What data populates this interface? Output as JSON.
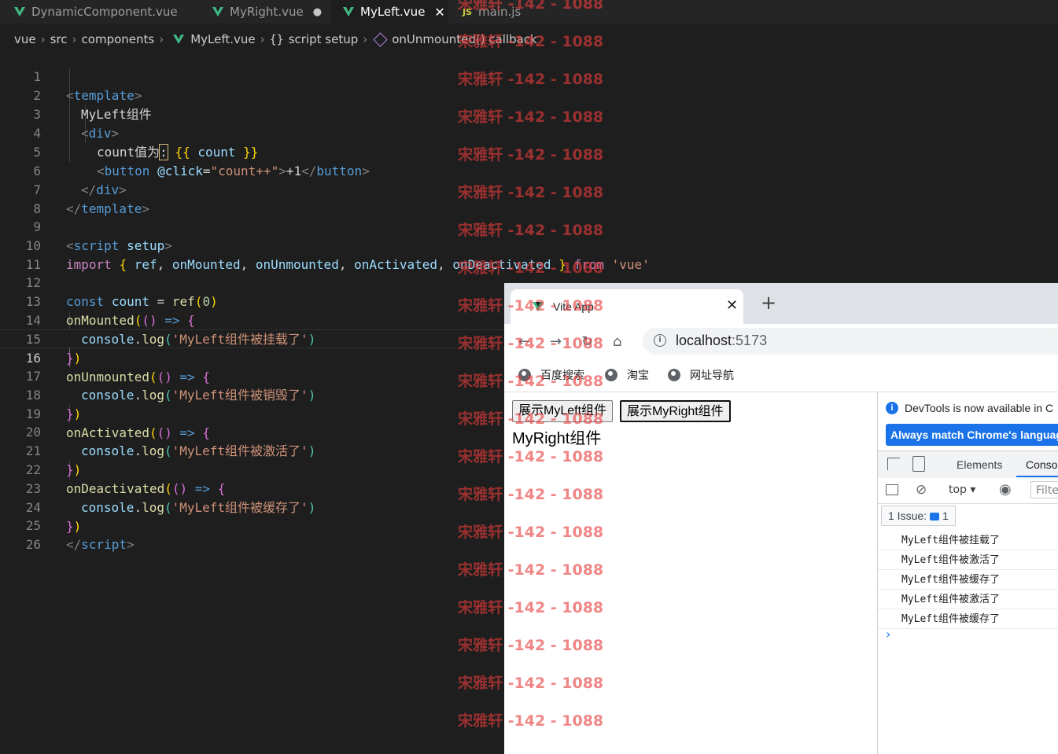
{
  "editor": {
    "tabs": [
      {
        "label": "DynamicComponent.vue",
        "icon": "vue-icon",
        "active": false
      },
      {
        "label": "MyRight.vue",
        "icon": "vue-icon",
        "modified": true,
        "active": false
      },
      {
        "label": "MyLeft.vue",
        "icon": "vue-icon",
        "active": true
      },
      {
        "label": "main.js",
        "icon": "js-icon",
        "active": false
      }
    ],
    "js_badge": "JS",
    "breadcrumb": [
      "vue",
      "src",
      "components",
      "MyLeft.vue",
      "script setup",
      "onUnmounted() callback"
    ],
    "breadcrumb_braces": "{}",
    "lines": [
      "1",
      "2",
      "3",
      "4",
      "5",
      "6",
      "7",
      "8",
      "9",
      "10",
      "11",
      "12",
      "13",
      "14",
      "15",
      "16",
      "17",
      "18",
      "19",
      "20",
      "21",
      "22",
      "23",
      "24",
      "25",
      "26"
    ],
    "code": {
      "l1_tag": "template",
      "l2_text": "MyLeft组件",
      "l3_tag": "div",
      "l4_text": "count值为",
      "l4_colon": ":",
      "l4_var": "count",
      "l5_tag": "button",
      "l5_attr": "@click",
      "l5_val": "\"count++\"",
      "l5_text": "+1",
      "l9_tag": "script",
      "l9_attr": "setup",
      "l10_kw": "import",
      "l10_names": [
        "ref",
        "onMounted",
        "onUnmounted",
        "onActivated",
        "onDeactivated"
      ],
      "l10_from": "from",
      "l10_str": "'vue'",
      "l12_decl": "const",
      "l12_var": "count",
      "l12_fn": "ref",
      "l12_num": "0",
      "hooks": [
        {
          "fn": "onMounted",
          "log": "'MyLeft组件被挂载了'"
        },
        {
          "fn": "onUnmounted",
          "log": "'MyLeft组件被销毁了'"
        },
        {
          "fn": "onActivated",
          "log": "'MyLeft组件被激活了'"
        },
        {
          "fn": "onDeactivated",
          "log": "'MyLeft组件被缓存了'"
        }
      ],
      "console": "console",
      "log": "log"
    }
  },
  "browser": {
    "tab_title": "Vite App",
    "url_host": "localhost",
    "url_port": ":5173",
    "bookmarks": [
      "百度搜索",
      "淘宝",
      "网址导航"
    ],
    "page": {
      "buttons": [
        "展示MyLeft组件",
        "展示MyRight组件"
      ],
      "text": "MyRight组件"
    },
    "devtools": {
      "info": "DevTools is now available in C",
      "match_button": "Always match Chrome's languag",
      "tabs": [
        "Elements",
        "Conso"
      ],
      "context": "top",
      "filter_placeholder": "Filte",
      "issues_label": "1 Issue:",
      "issues_count": "1",
      "logs": [
        "MyLeft组件被挂载了",
        "MyLeft组件被激活了",
        "MyLeft组件被缓存了",
        "MyLeft组件被激活了",
        "MyLeft组件被缓存了"
      ]
    }
  },
  "watermark": "宋雅轩 -142 - 1088"
}
